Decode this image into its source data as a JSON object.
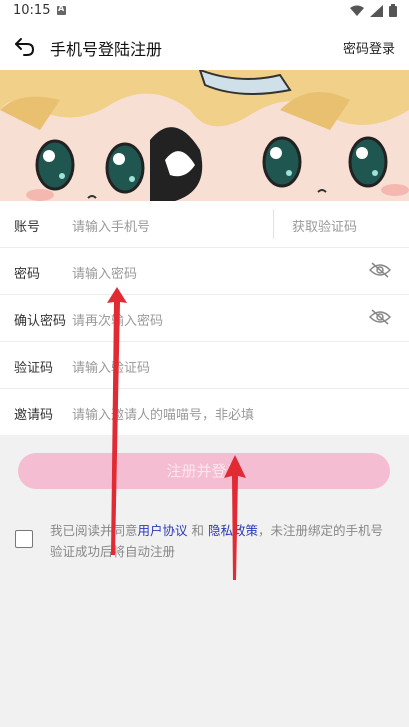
{
  "status_bar": {
    "time": "10:15"
  },
  "header": {
    "title": "手机号登陆注册",
    "password_login": "密码登录"
  },
  "form": {
    "account_label": "账号",
    "account_placeholder": "请输入手机号",
    "get_code_label": "获取验证码",
    "password_label": "密码",
    "password_placeholder": "请输入密码",
    "confirm_label": "确认密码",
    "confirm_placeholder": "请再次输入密码",
    "code_label": "验证码",
    "code_placeholder": "请输入验证码",
    "invite_label": "邀请码",
    "invite_placeholder": "请输入邀请人的喵喵号，非必填"
  },
  "submit_label": "注册并登录",
  "agreement": {
    "prefix": "我已阅读并同意",
    "user_agreement": "用户协议",
    "and": " 和 ",
    "privacy_policy": "隐私政策",
    "suffix": "，未注册绑定的手机号验证成功后将自动注册"
  },
  "colors": {
    "accent_pink": "#f5bdd1",
    "link_blue": "#2a39b8",
    "arrow_red": "#e02b35"
  },
  "icons": [
    "back-arrow-icon",
    "eye-off-icon",
    "wifi-icon",
    "signal-icon",
    "battery-icon",
    "sim-icon"
  ]
}
